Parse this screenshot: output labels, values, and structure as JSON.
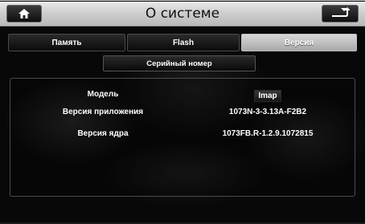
{
  "header": {
    "title": "О системе",
    "home_icon": "home-icon",
    "back_icon": "back-arrow-icon"
  },
  "tabs": [
    {
      "label": "Память",
      "active": false
    },
    {
      "label": "Flash",
      "active": false
    },
    {
      "label": "Версия",
      "active": true
    }
  ],
  "serial_button": {
    "label": "Серийный номер"
  },
  "info": {
    "rows": [
      {
        "label": "Модель",
        "value": "Imap"
      },
      {
        "label": "Версия приложения",
        "value": "1073N-3-3.13A-F2B2"
      },
      {
        "label": "Версия ядра",
        "value": "1073FB.R-1.2.9.1072815"
      }
    ]
  },
  "colors": {
    "titlebar": "#cfcfcf",
    "active_tab": "#c0c0c0",
    "background": "#080808"
  }
}
